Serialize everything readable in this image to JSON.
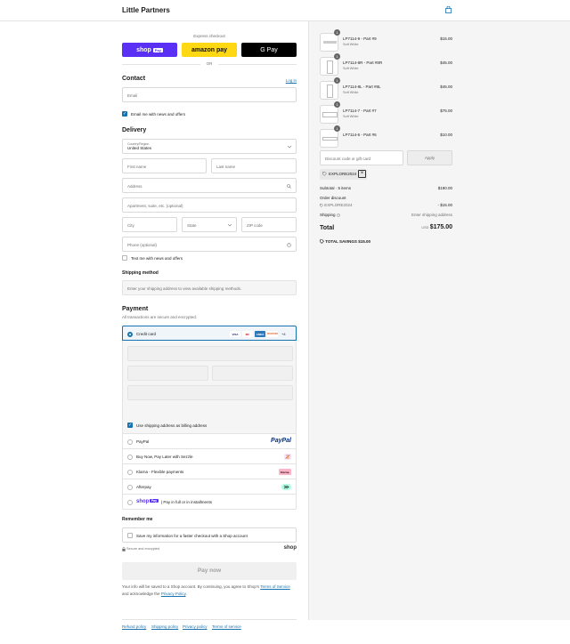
{
  "header": {
    "brand": "Little Partners",
    "cart_icon": "shopping-bag-icon"
  },
  "express": {
    "title": "Express checkout",
    "buttons": [
      {
        "label": "shop",
        "badge": "Pay",
        "color": "#5a31f4"
      },
      {
        "label": "amazon pay",
        "color": "#ffd814"
      },
      {
        "label": "G Pay",
        "color": "#000000"
      }
    ],
    "or": "OR"
  },
  "contact": {
    "title": "Contact",
    "login": "Log in",
    "email_placeholder": "Email",
    "news_label": "Email me with news and offers"
  },
  "delivery": {
    "title": "Delivery",
    "country_label": "Country/Region",
    "country_value": "United States",
    "first_name": "First name",
    "last_name": "Last name",
    "address": "Address",
    "apartment": "Apartment, suite, etc. (optional)",
    "city": "City",
    "state": "State",
    "zip": "ZIP code",
    "phone": "Phone (optional)",
    "text_news": "Text me with news and offers"
  },
  "shipping": {
    "title": "Shipping method",
    "message": "Enter your shipping address to view available shipping methods."
  },
  "payment": {
    "title": "Payment",
    "subtitle": "All transactions are secure and encrypted.",
    "credit_card": "Credit card",
    "card_logos": [
      "VISA",
      "MC",
      "AMEX",
      "DISCOVER"
    ],
    "more": "+4",
    "billing_label": "Use shipping address as billing address",
    "options": [
      {
        "name": "PayPal",
        "logo": "PayPal"
      },
      {
        "name": "Buy Now, Pay Later with Sezzle"
      },
      {
        "name": "Klarna - Flexible payments",
        "logo": "Klarna."
      },
      {
        "name": "Afterpay"
      },
      {
        "name": "Pay in full or in installments",
        "logo": "shop",
        "badge": "Pay"
      }
    ]
  },
  "remember": {
    "title": "Remember me",
    "label": "Save my information for a faster checkout with a Shop account",
    "secure": "Secure and encrypted",
    "shop": "shop"
  },
  "pay_now": "Pay now",
  "legal": {
    "text": "Your info will be saved to a Shop account. By continuing, you agree to Shop's",
    "terms": "Terms of Service",
    "and": "and acknowledge the",
    "privacy": "Privacy Policy",
    "dot": "."
  },
  "footer": [
    "Refund policy",
    "Shipping policy",
    "Privacy policy",
    "Terms of service"
  ],
  "cart": {
    "items": [
      {
        "qty": "1",
        "name": "LP7114-9 - Part #9",
        "variant": "Soft White",
        "price": "$15.00"
      },
      {
        "qty": "1",
        "name": "LP7114-8R - Part #8R",
        "variant": "Soft White",
        "price": "$45.00"
      },
      {
        "qty": "1",
        "name": "LP7114-8L - Part #8L",
        "variant": "Soft White",
        "price": "$45.00"
      },
      {
        "qty": "1",
        "name": "LP7114-7 - Part #7",
        "variant": "Soft White",
        "price": "$75.00"
      },
      {
        "qty": "1",
        "name": "LP7114-6 - Part #6",
        "variant": "",
        "price": "$10.00"
      }
    ],
    "discount_placeholder": "Discount code or gift card",
    "apply": "Apply",
    "applied_code": "EXPLORE2024",
    "subtotal_label": "Subtotal · 5 items",
    "subtotal": "$190.00",
    "order_discount": "Order discount",
    "discount_code": "EXPLORE2024",
    "discount_amount": "- $15.00",
    "shipping_label": "Shipping",
    "shipping_value": "Enter shipping address",
    "total_label": "Total",
    "currency": "USD",
    "total": "$175.00",
    "savings_label": "TOTAL SAVINGS",
    "savings": "$15.00"
  }
}
